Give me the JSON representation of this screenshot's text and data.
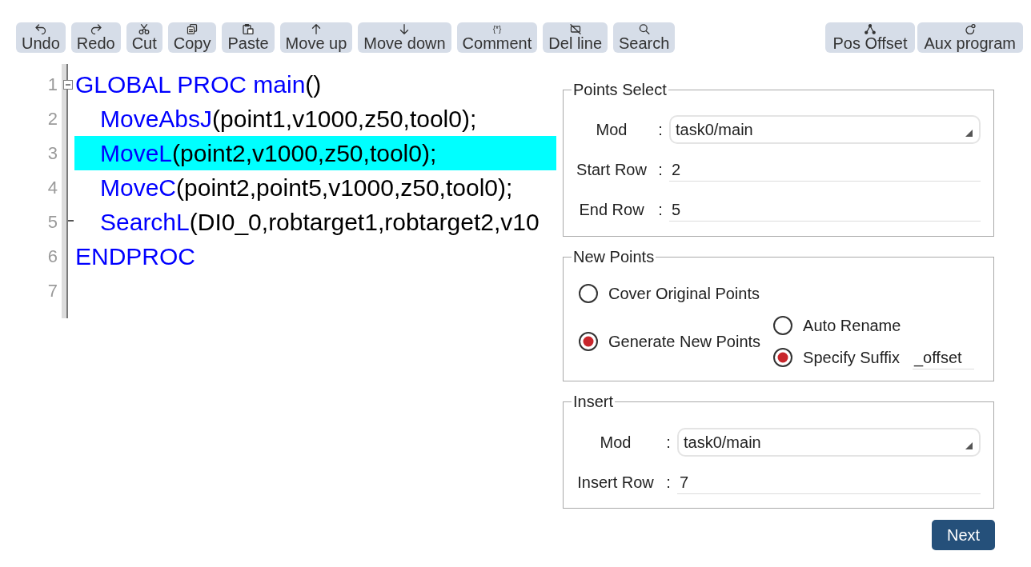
{
  "toolbar": {
    "left_buttons": [
      {
        "label": "Undo",
        "kind": "undo"
      },
      {
        "label": "Redo",
        "kind": "redo"
      },
      {
        "label": "Cut",
        "kind": "cut"
      },
      {
        "label": "Copy",
        "kind": "copy"
      },
      {
        "label": "Paste",
        "kind": "paste"
      },
      {
        "label": "Move up",
        "kind": "up"
      },
      {
        "label": "Move down",
        "kind": "down"
      },
      {
        "label": "Comment",
        "kind": "glyph",
        "glyph": "{*}"
      },
      {
        "label": "Del line",
        "kind": "delete"
      },
      {
        "label": "Search",
        "kind": "search"
      }
    ],
    "right_buttons": [
      {
        "label": "Pos Offset",
        "kind": "branch"
      },
      {
        "label": "Aux program",
        "kind": "ring"
      }
    ]
  },
  "editor": {
    "lines": [
      {
        "number": "1",
        "selected": false,
        "expanded": true,
        "tokens": [
          {
            "text": "GLOBAL PROC main",
            "kind": "keyword"
          },
          {
            "text": "()",
            "kind": "plain"
          }
        ],
        "children": [
          {
            "number": "2",
            "selected": false,
            "tokens": [
              {
                "text": "MoveAbsJ",
                "kind": "keyword"
              },
              {
                "text": "(point1,v1000,z50,tool0);",
                "kind": "plain"
              }
            ]
          },
          {
            "number": "3",
            "selected": true,
            "tokens": [
              {
                "text": "MoveL",
                "kind": "keyword"
              },
              {
                "text": "(point2,v1000,z50,tool0);",
                "kind": "plain"
              }
            ]
          },
          {
            "number": "4",
            "selected": false,
            "tokens": [
              {
                "text": "MoveC",
                "kind": "keyword"
              },
              {
                "text": "(point2,point5,v1000,z50,tool0);",
                "kind": "plain"
              }
            ]
          },
          {
            "number": "5",
            "selected": false,
            "tokens": [
              {
                "text": "SearchL",
                "kind": "keyword"
              },
              {
                "text": "(DI0_0,robtarget1,robtarget2,v10",
                "kind": "plain"
              }
            ]
          }
        ]
      },
      {
        "number": "6",
        "selected": false,
        "tokens": [
          {
            "text": "ENDPROC",
            "kind": "keyword"
          }
        ]
      },
      {
        "number": "7",
        "selected": false
      }
    ]
  },
  "points_select": {
    "title": "Points Select",
    "fields": [
      {
        "label": "Mod",
        "separator": ":",
        "kind": "dropdown",
        "value": "task0/main"
      },
      {
        "label": "Start Row",
        "separator": ":",
        "kind": "text",
        "value": "2"
      },
      {
        "label": "End Row",
        "separator": ":",
        "kind": "text",
        "value": "5"
      }
    ]
  },
  "new_points": {
    "title": "New Points",
    "options": [
      {
        "label": "Cover Original Points",
        "selected": false
      },
      {
        "label": "Generate New Points",
        "selected": true,
        "sub_options": [
          {
            "label": "Auto Rename",
            "selected": false
          },
          {
            "label": "Specify Suffix",
            "selected": true,
            "value": "_offset"
          }
        ]
      }
    ]
  },
  "insert": {
    "title": "Insert",
    "fields": [
      {
        "label": "Mod",
        "separator": ":",
        "kind": "dropdown",
        "value": "task0/main"
      },
      {
        "label": "Insert Row",
        "separator": ":",
        "kind": "text",
        "value": "7"
      }
    ]
  },
  "next_button": {
    "label": "Next"
  }
}
